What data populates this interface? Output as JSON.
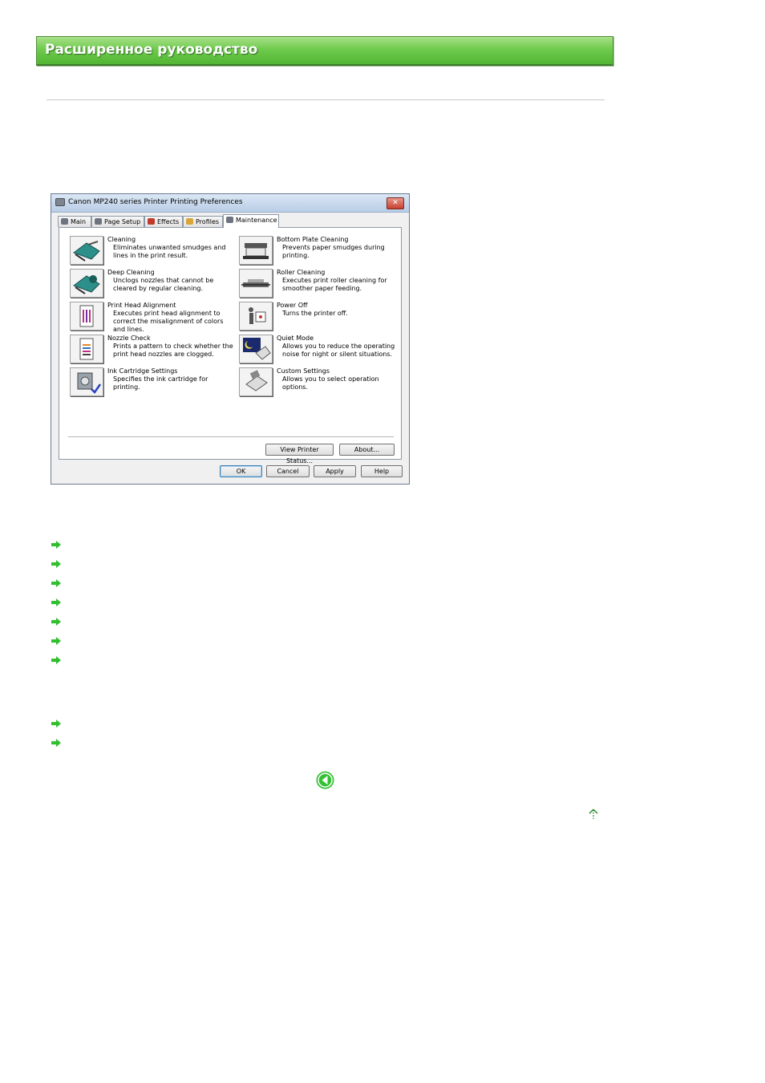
{
  "banner": {
    "title": "Расширенное руководство"
  },
  "dialog": {
    "title": "Canon MP240 series Printer Printing Preferences",
    "close": "✕",
    "tabs": [
      "Main",
      "Page Setup",
      "Effects",
      "Profiles",
      "Maintenance"
    ],
    "active_tab": "Maintenance",
    "items_left": [
      {
        "name": "Cleaning",
        "desc": "Eliminates unwanted smudges and lines in the print result.",
        "icon": "cleaning-icon"
      },
      {
        "name": "Deep Cleaning",
        "desc": "Unclogs nozzles that cannot be cleared by regular cleaning.",
        "icon": "deep-cleaning-icon"
      },
      {
        "name": "Print Head Alignment",
        "desc": "Executes print head alignment to correct the misalignment of colors and lines.",
        "icon": "print-head-alignment-icon"
      },
      {
        "name": "Nozzle Check",
        "desc": "Prints a pattern to check whether the print head nozzles are clogged.",
        "icon": "nozzle-check-icon"
      },
      {
        "name": "Ink Cartridge Settings",
        "desc": "Specifies the ink cartridge for printing.",
        "icon": "ink-cartridge-icon"
      }
    ],
    "items_right": [
      {
        "name": "Bottom Plate Cleaning",
        "desc": "Prevents paper smudges during printing.",
        "icon": "bottom-plate-icon"
      },
      {
        "name": "Roller Cleaning",
        "desc": "Executes print roller cleaning for smoother paper feeding.",
        "icon": "roller-icon"
      },
      {
        "name": "Power Off",
        "desc": "Turns the printer off.",
        "icon": "power-off-icon"
      },
      {
        "name": "Quiet Mode",
        "desc": "Allows you to reduce the operating noise for night or silent situations.",
        "icon": "quiet-mode-icon"
      },
      {
        "name": "Custom Settings",
        "desc": "Allows you to select operation options.",
        "icon": "custom-settings-icon"
      }
    ],
    "buttons": {
      "view_status": "View Printer Status...",
      "about": "About...",
      "ok": "OK",
      "cancel": "Cancel",
      "apply": "Apply",
      "help": "Help"
    }
  },
  "colors": {
    "banner_green": "#6fcb4d",
    "link_arrow": "#2fbf2f"
  }
}
